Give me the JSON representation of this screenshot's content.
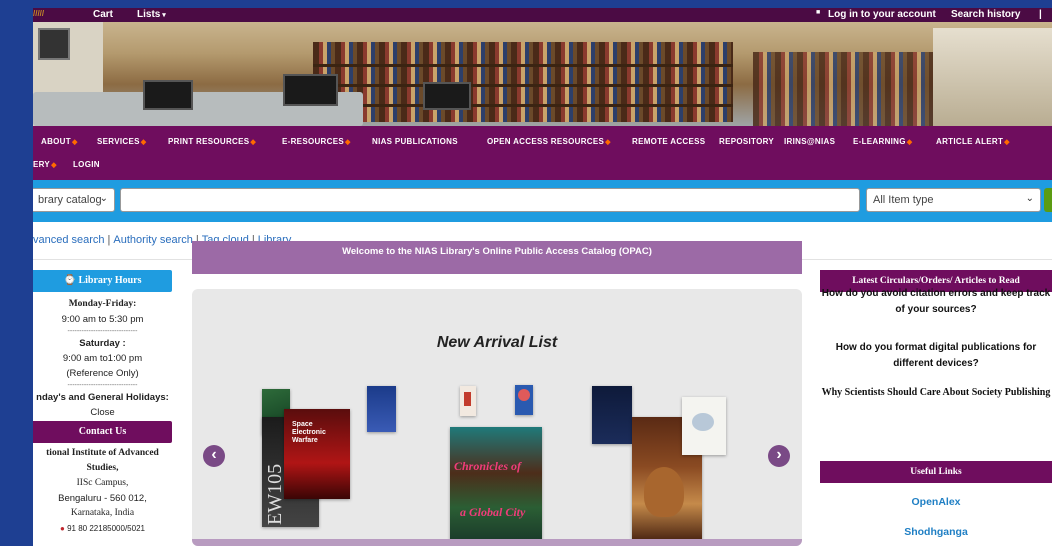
{
  "topbar": {
    "cart": "Cart",
    "lists": "Lists",
    "login": "Log in to your account",
    "search_history": "Search history"
  },
  "nav": {
    "items": [
      {
        "label": "ABOUT",
        "caret": true
      },
      {
        "label": "SERVICES",
        "caret": true
      },
      {
        "label": "PRINT RESOURCES",
        "caret": true
      },
      {
        "label": "E-RESOURCES",
        "caret": true
      },
      {
        "label": "NIAS PUBLICATIONS",
        "caret": false
      },
      {
        "label": "OPEN ACCESS RESOURCES",
        "caret": true
      },
      {
        "label": "REMOTE ACCESS",
        "caret": false
      },
      {
        "label": "REPOSITORY",
        "caret": false
      },
      {
        "label": "IRINS@NIAS",
        "caret": false
      },
      {
        "label": "E-LEARNING",
        "caret": true
      },
      {
        "label": "ARTICLE ALERT",
        "caret": true
      }
    ],
    "row2": [
      {
        "label": "ERY",
        "caret": true
      },
      {
        "label": "LOGIN",
        "caret": false
      }
    ]
  },
  "search": {
    "catalog_select": "brary catalog",
    "query_value": "",
    "item_type_select": "All Item type"
  },
  "links": {
    "advanced": "vanced search",
    "authority": "Authority search",
    "tagcloud": "Tag cloud",
    "library": "Library"
  },
  "sidebar": {
    "hours_title": "Library Hours",
    "weekday_label": "Monday-Friday:",
    "weekday_hours": "9:00 am to 5:30 pm",
    "dots": "------------------------------",
    "saturday_label": "Saturday :",
    "saturday_hours": "9:00 am to1:00 pm",
    "saturday_note": "(Reference Only)",
    "holidays_label": "nday's and General Holidays:",
    "holidays_value": "Close",
    "contact_title": "Contact Us",
    "inst_line1": "tional Institute of Advanced",
    "inst_line2": "Studies,",
    "address1": "IISc Campus,",
    "address2": "Bengaluru - 560 012,",
    "address3": "Karnataka, India",
    "phone": "91 80 22185000/5021"
  },
  "main": {
    "welcome": "Welcome to the NIAS Library's Online Public Access Catalog (OPAC)",
    "carousel_title": "New Arrival List",
    "prev": "‹",
    "next": "›",
    "book_texts": {
      "ew": "EW105",
      "space": "Space Electronic Warfare",
      "chronicles": "Chronicles of",
      "global": "a Global City"
    }
  },
  "right": {
    "circulars_title": "Latest Circulars/Orders/ Articles to Read",
    "item1": "How do you avoid citation errors and keep track of your sources?",
    "item2": "How do you format digital publications for different devices?",
    "item3": "Why Scientists Should Care About Society Publishing",
    "useful_title": "Useful Links",
    "link1": "OpenAlex",
    "link2": "Shodhganga"
  },
  "colors": {
    "purple": "#6f0d5e",
    "blue": "#1f9ce0",
    "frame": "#1e3f92"
  }
}
